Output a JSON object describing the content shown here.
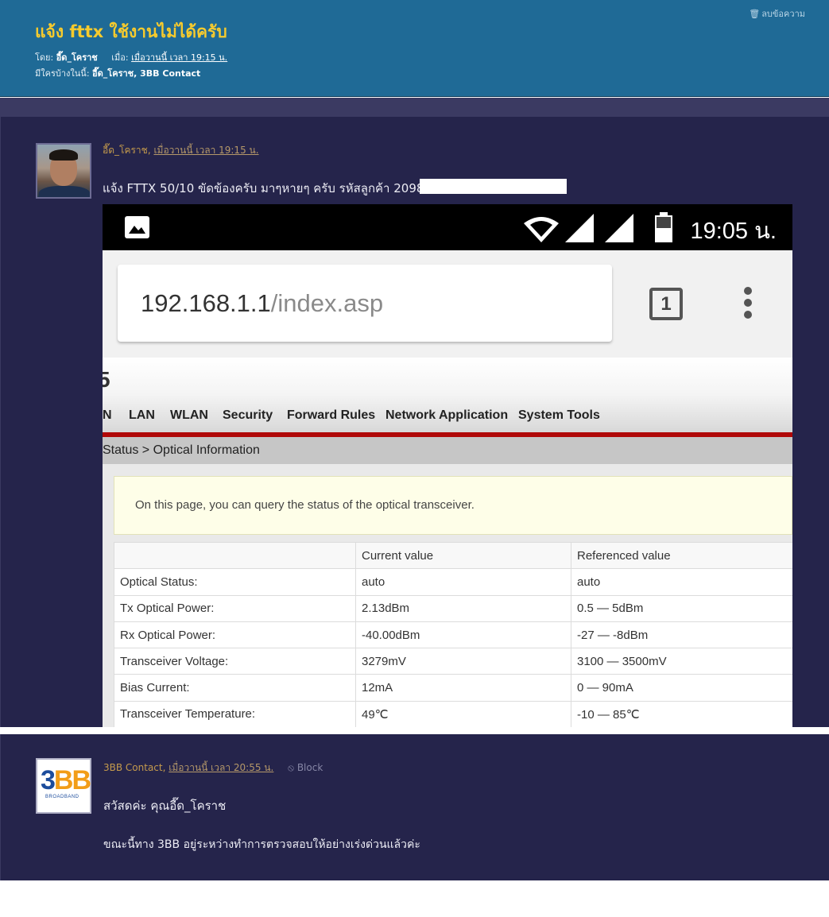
{
  "thread": {
    "title": "แจ้ง fttx ใช้งานไม่ได้ครับ",
    "delete_label": "ลบข้อความ",
    "by_label": "โดย:",
    "author": "อี๊ด_โคราช",
    "when_label": "เมื่อ:",
    "when_value": "เมื่อวานนี้ เวลา 19:15 น.",
    "viewers_label": "มีใครบ้างในนี้:",
    "viewers": "อี๊ด_โคราช, 3BB Contact"
  },
  "post1": {
    "author": "อี๊ด_โคราช",
    "time": "เมื่อวานนี้ เวลา 19:15 น.",
    "text": "แจ้ง  FTTX 50/10 ขัดข้องครับ มาๆหายๆ ครับ รหัสลูกค้า 2098"
  },
  "screenshot": {
    "clock": "19:05 น.",
    "url_host": "192.168.1.1",
    "url_path": "/index.asp",
    "tabs_count": "1",
    "logo_fragment": "5",
    "nav": [
      "N",
      "LAN",
      "WLAN",
      "Security",
      "Forward Rules",
      "Network Application",
      "System Tools"
    ],
    "breadcrumb": "Status > Optical Information",
    "info": "On this page, you can query the status of the optical transceiver.",
    "table": {
      "headers": [
        "",
        "Current value",
        "Referenced value"
      ],
      "rows": [
        [
          "Optical Status:",
          "auto",
          "auto"
        ],
        [
          "Tx Optical Power:",
          "2.13dBm",
          "0.5 — 5dBm"
        ],
        [
          "Rx Optical Power:",
          "-40.00dBm",
          "-27 — -8dBm"
        ],
        [
          "Transceiver Voltage:",
          "3279mV",
          "3100 — 3500mV"
        ],
        [
          "Bias Current:",
          "12mA",
          "0 — 90mA"
        ],
        [
          "Transceiver Temperature:",
          "49℃",
          "-10 — 85℃"
        ]
      ]
    }
  },
  "post2": {
    "author": "3BB Contact",
    "time": "เมื่อวานนี้ เวลา 20:55 น.",
    "block_label": "Block",
    "avatar_logo_a": "3",
    "avatar_logo_b": "BB",
    "avatar_sub": "BROADBAND",
    "line1": "สวัสดค่ะ คุณอี๊ด_โคราช",
    "line2": "ขณะนี้ทาง 3BB อยู่ระหว่างทำการตรวจสอบให้อย่างเร่งด่วนแล้วค่ะ"
  },
  "colors": {
    "header_bg": "#1f6a96",
    "title": "#f7cb2d",
    "post_bg": "#25244b",
    "router_red": "#b00808",
    "meta_gold": "#c49a4c"
  }
}
